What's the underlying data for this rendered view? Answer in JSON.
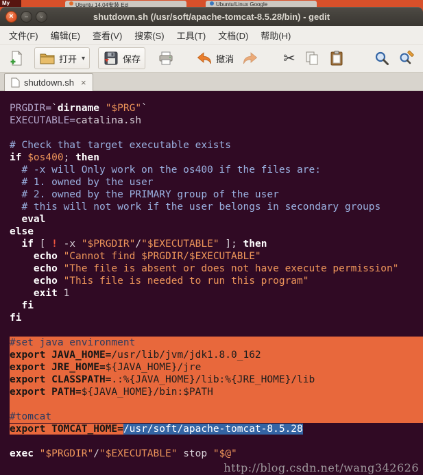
{
  "background_strip": {
    "left_label": "My",
    "tab1": "Ubuntu 14.04安装 Ecl",
    "tab2": "Ubuntu/Linux Google"
  },
  "window": {
    "title": "shutdown.sh (/usr/soft/apache-tomcat-8.5.28/bin) - gedit",
    "controls": {
      "close_glyph": "×",
      "minimize_glyph": "–",
      "maximize_glyph": "▫"
    }
  },
  "menu_bar": {
    "items": [
      "文件(F)",
      "编辑(E)",
      "查看(V)",
      "搜索(S)",
      "工具(T)",
      "文档(D)",
      "帮助(H)"
    ]
  },
  "toolbar": {
    "open_label": "打开",
    "save_label": "保存",
    "undo_label": "撤消",
    "dropdown_glyph": "▾",
    "cut_glyph": "✂"
  },
  "tab_bar": {
    "active_tab": "shutdown.sh",
    "close_glyph": "×"
  },
  "colors": {
    "selection_orange": "#e8683c",
    "selection_blue": "#3465a4",
    "editor_background": "#300a24"
  },
  "editor": {
    "watermark": "http://blog.csdn.net/wang342626",
    "lines": [
      {
        "s": [
          {
            "t": "PRGDIR=",
            "c": "var"
          },
          {
            "t": "`",
            "c": "def"
          },
          {
            "t": "dirname",
            "c": "kw"
          },
          {
            "t": " ",
            "c": "def"
          },
          {
            "t": "\"$PRG\"",
            "c": "st"
          },
          {
            "t": "`",
            "c": "def"
          }
        ]
      },
      {
        "s": [
          {
            "t": "EXECUTABLE=",
            "c": "var"
          },
          {
            "t": "catalina.sh",
            "c": "def"
          }
        ]
      },
      {
        "s": []
      },
      {
        "s": [
          {
            "t": "# Check that target executable exists",
            "c": "cm"
          }
        ]
      },
      {
        "s": [
          {
            "t": "if",
            "c": "kw"
          },
          {
            "t": " ",
            "c": "def"
          },
          {
            "t": "$os400",
            "c": "st"
          },
          {
            "t": "; ",
            "c": "def"
          },
          {
            "t": "then",
            "c": "kw"
          }
        ]
      },
      {
        "s": [
          {
            "t": "  # -x will Only work on the os400 if the files are:",
            "c": "cm"
          }
        ]
      },
      {
        "s": [
          {
            "t": "  # 1. owned by the user",
            "c": "cm"
          }
        ]
      },
      {
        "s": [
          {
            "t": "  # 2. owned by the PRIMARY group of the user",
            "c": "cm"
          }
        ]
      },
      {
        "s": [
          {
            "t": "  # this will not work if the user belongs in secondary groups",
            "c": "cm"
          }
        ]
      },
      {
        "s": [
          {
            "t": "  ",
            "c": "def"
          },
          {
            "t": "eval",
            "c": "kw"
          }
        ]
      },
      {
        "s": [
          {
            "t": "else",
            "c": "kw"
          }
        ]
      },
      {
        "s": [
          {
            "t": "  ",
            "c": "def"
          },
          {
            "t": "if",
            "c": "kw"
          },
          {
            "t": " [ ",
            "c": "def"
          },
          {
            "t": "!",
            "c": "red"
          },
          {
            "t": " -x ",
            "c": "def"
          },
          {
            "t": "\"$PRGDIR\"",
            "c": "st"
          },
          {
            "t": "/",
            "c": "def"
          },
          {
            "t": "\"$EXECUTABLE\"",
            "c": "st"
          },
          {
            "t": " ]; ",
            "c": "def"
          },
          {
            "t": "then",
            "c": "kw"
          }
        ]
      },
      {
        "s": [
          {
            "t": "    ",
            "c": "def"
          },
          {
            "t": "echo",
            "c": "kw"
          },
          {
            "t": " ",
            "c": "def"
          },
          {
            "t": "\"Cannot find $PRGDIR/$EXECUTABLE\"",
            "c": "st"
          }
        ]
      },
      {
        "s": [
          {
            "t": "    ",
            "c": "def"
          },
          {
            "t": "echo",
            "c": "kw"
          },
          {
            "t": " ",
            "c": "def"
          },
          {
            "t": "\"The file is absent or does not have execute permission\"",
            "c": "st"
          }
        ]
      },
      {
        "s": [
          {
            "t": "    ",
            "c": "def"
          },
          {
            "t": "echo",
            "c": "kw"
          },
          {
            "t": " ",
            "c": "def"
          },
          {
            "t": "\"This file is needed to run this program\"",
            "c": "st"
          }
        ]
      },
      {
        "s": [
          {
            "t": "    ",
            "c": "def"
          },
          {
            "t": "exit",
            "c": "kw"
          },
          {
            "t": " 1",
            "c": "def"
          }
        ]
      },
      {
        "s": [
          {
            "t": "  ",
            "c": "def"
          },
          {
            "t": "fi",
            "c": "kw"
          }
        ]
      },
      {
        "s": [
          {
            "t": "fi",
            "c": "kw"
          }
        ]
      },
      {
        "s": []
      },
      {
        "hl": "full",
        "s": [
          {
            "t": "#set java environment",
            "c": "scm"
          }
        ]
      },
      {
        "hl": "full",
        "s": [
          {
            "t": "export ",
            "c": "skw"
          },
          {
            "t": "JAVA_HOME=",
            "c": "skw"
          },
          {
            "t": "/usr/lib/jvm/jdk1.8.0_162",
            "c": "sd"
          }
        ]
      },
      {
        "hl": "full",
        "s": [
          {
            "t": "export ",
            "c": "skw"
          },
          {
            "t": "JRE_HOME=",
            "c": "skw"
          },
          {
            "t": "${JAVA_HOME}/jre",
            "c": "sd"
          }
        ]
      },
      {
        "hl": "full",
        "s": [
          {
            "t": "export ",
            "c": "skw"
          },
          {
            "t": "CLASSPATH=",
            "c": "skw"
          },
          {
            "t": ".:%{JAVA_HOME}/lib:%{JRE_HOME}/lib",
            "c": "sd"
          }
        ]
      },
      {
        "hl": "full",
        "s": [
          {
            "t": "export ",
            "c": "skw"
          },
          {
            "t": "PATH=",
            "c": "skw"
          },
          {
            "t": "${JAVA_HOME}/bin:$PATH",
            "c": "sd"
          }
        ]
      },
      {
        "hl": "full",
        "s": []
      },
      {
        "hl": "full",
        "s": [
          {
            "t": "#tomcat",
            "c": "scm"
          }
        ]
      },
      {
        "hl": "partial",
        "s": [
          {
            "t": "export ",
            "c": "skw"
          },
          {
            "t": "TOMCAT_HOME=",
            "c": "skw"
          },
          {
            "t": "/usr/soft/apache-tomcat-8.5.28",
            "c": "sblue"
          }
        ]
      },
      {
        "s": []
      },
      {
        "s": [
          {
            "t": "exec",
            "c": "kw"
          },
          {
            "t": " ",
            "c": "def"
          },
          {
            "t": "\"$PRGDIR\"",
            "c": "st"
          },
          {
            "t": "/",
            "c": "def"
          },
          {
            "t": "\"$EXECUTABLE\"",
            "c": "st"
          },
          {
            "t": " stop ",
            "c": "def"
          },
          {
            "t": "\"$@\"",
            "c": "st"
          }
        ]
      }
    ]
  }
}
